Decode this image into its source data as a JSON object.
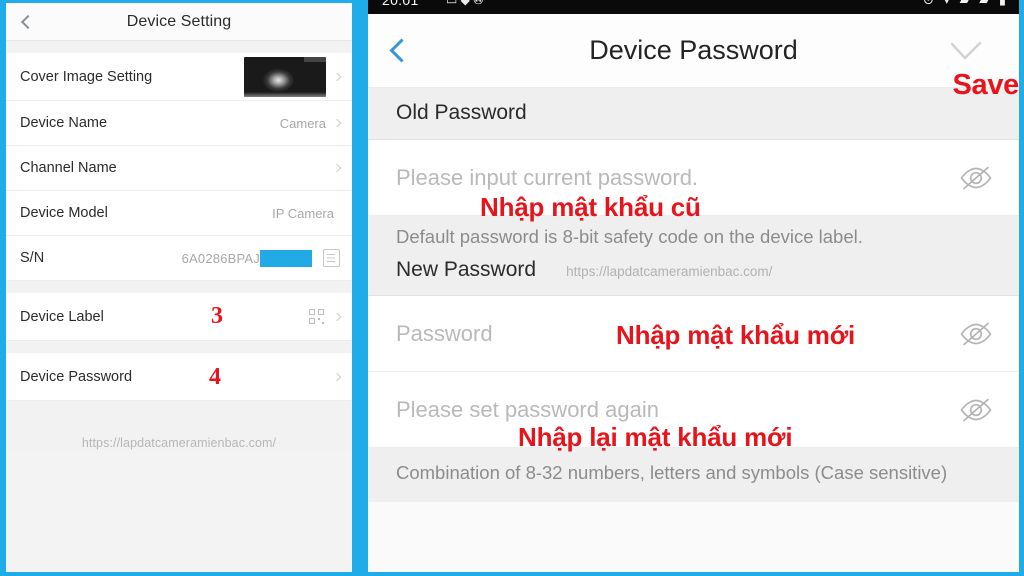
{
  "theme": {
    "frame_blue": "#1fadea",
    "annotation_red": "#e8141c",
    "back_arrow_blue": "#3a95d8"
  },
  "left_panel": {
    "header": {
      "title": "Device Setting",
      "back_icon": "chevron-left-icon"
    },
    "rows": [
      {
        "label": "Cover Image Setting",
        "value": "",
        "accessory": "thumbnail",
        "chevron": true,
        "annotation": ""
      },
      {
        "label": "Device Name",
        "value": "Camera",
        "accessory": "none",
        "chevron": true,
        "annotation": ""
      },
      {
        "label": "Channel Name",
        "value": "",
        "accessory": "none",
        "chevron": true,
        "annotation": ""
      },
      {
        "label": "Device Model",
        "value": "IP Camera",
        "accessory": "none",
        "chevron": false,
        "annotation": ""
      },
      {
        "label": "S/N",
        "value": "6A0286BPAJ",
        "accessory": "copy",
        "chevron": false,
        "annotation": "",
        "redacted": true
      },
      {
        "label": "Device Label",
        "value": "",
        "accessory": "qr",
        "chevron": true,
        "annotation": "3"
      },
      {
        "label": "Device Password",
        "value": "",
        "accessory": "none",
        "chevron": true,
        "annotation": "4"
      }
    ],
    "watermark": "https://lapdatcameramienbac.com/"
  },
  "right_panel": {
    "status_bar": {
      "time": "20:01",
      "left_icons": "▭ ◆ ✇",
      "right_icons": "⊙ ▾ ▰ ▰ ▮"
    },
    "header": {
      "title": "Device Password",
      "back_icon": "chevron-left-icon",
      "save_icon": "check-icon",
      "save_annotation": "Save"
    },
    "old_password_section": {
      "heading": "Old Password",
      "input_placeholder": "Please input current password.",
      "eye_icon": "eye-slash-icon",
      "annotation": "Nhập mật khẩu cũ"
    },
    "default_hint": "Default password is 8-bit safety code on the device label.",
    "new_password_section": {
      "heading": "New Password",
      "watermark": "https://lapdatcameramienbac.com/",
      "input_placeholder": "Password",
      "eye_icon": "eye-slash-icon",
      "annotation": "Nhập mật khẩu mới"
    },
    "confirm_password_section": {
      "input_placeholder": "Please set password again",
      "eye_icon": "eye-slash-icon",
      "annotation": "Nhập lại mật khẩu mới"
    },
    "footer_note": "Combination of 8-32 numbers, letters and symbols (Case sensitive)"
  }
}
